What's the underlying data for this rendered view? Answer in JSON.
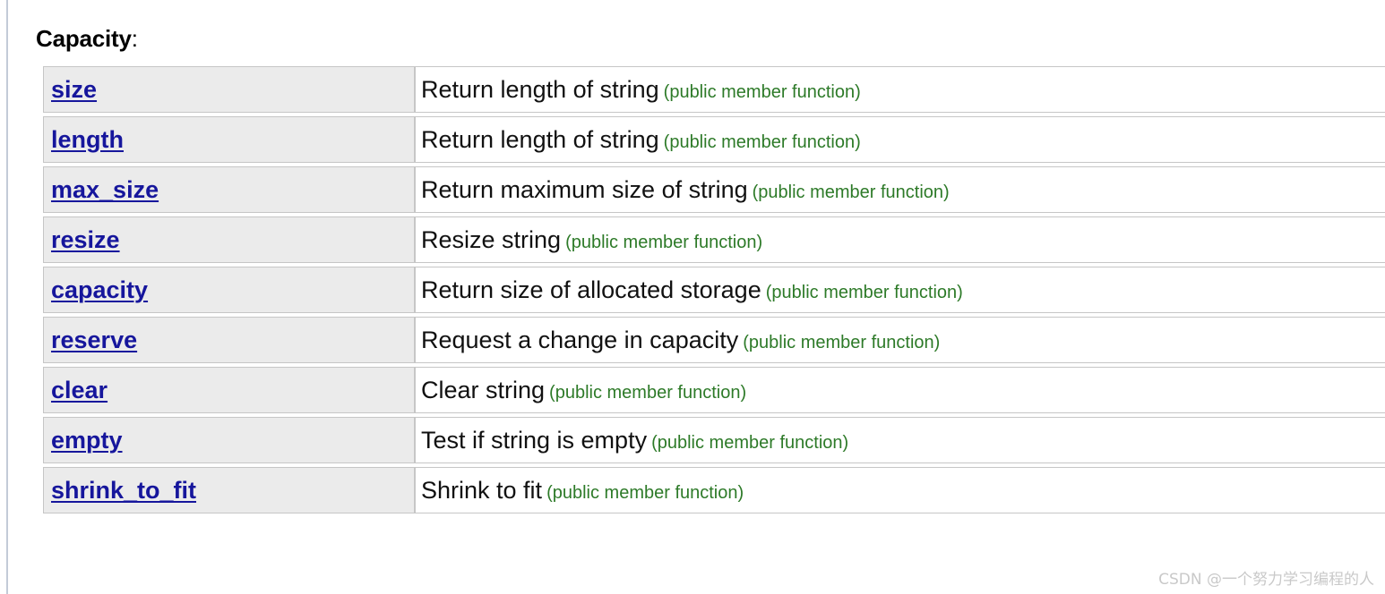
{
  "section": {
    "title": "Capacity",
    "colon": ":"
  },
  "table": {
    "rows": [
      {
        "name": "size",
        "description": "Return length of string",
        "note": "(public member function)"
      },
      {
        "name": "length",
        "description": "Return length of string",
        "note": "(public member function)"
      },
      {
        "name": "max_size",
        "description": "Return maximum size of string",
        "note": "(public member function)"
      },
      {
        "name": "resize",
        "description": "Resize string",
        "note": "(public member function)"
      },
      {
        "name": "capacity",
        "description": "Return size of allocated storage",
        "note": "(public member function)"
      },
      {
        "name": "reserve",
        "description": "Request a change in capacity",
        "note": "(public member function)"
      },
      {
        "name": "clear",
        "description": "Clear string",
        "note": "(public member function)"
      },
      {
        "name": "empty",
        "description": "Test if string is empty",
        "note": "(public member function)"
      },
      {
        "name": "shrink_to_fit",
        "description": "Shrink to fit",
        "note": "(public member function)"
      }
    ]
  },
  "watermark": {
    "text": "CSDN @一个努力学习编程的人"
  },
  "colors": {
    "link": "#16169c",
    "note": "#2d7a28",
    "name_cell_bg": "#ebebeb",
    "border": "#c6c6c6",
    "watermark": "#c9c9c9"
  }
}
